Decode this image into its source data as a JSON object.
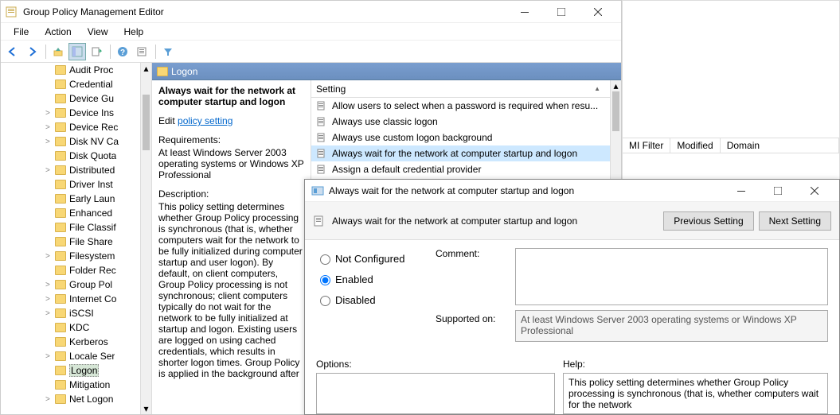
{
  "window": {
    "title": "Group Policy Management Editor"
  },
  "menu": {
    "file": "File",
    "action": "Action",
    "view": "View",
    "help": "Help"
  },
  "tree": {
    "items": [
      {
        "label": "Audit Proc",
        "exp": ""
      },
      {
        "label": "Credential",
        "exp": ""
      },
      {
        "label": "Device Gu",
        "exp": ""
      },
      {
        "label": "Device Ins",
        "exp": ">"
      },
      {
        "label": "Device Rec",
        "exp": ">"
      },
      {
        "label": "Disk NV Ca",
        "exp": ">"
      },
      {
        "label": "Disk Quota",
        "exp": ""
      },
      {
        "label": "Distributed",
        "exp": ">"
      },
      {
        "label": "Driver Inst",
        "exp": ""
      },
      {
        "label": "Early Laun",
        "exp": ""
      },
      {
        "label": "Enhanced",
        "exp": ""
      },
      {
        "label": "File Classif",
        "exp": ""
      },
      {
        "label": "File Share",
        "exp": ""
      },
      {
        "label": "Filesystem",
        "exp": ">"
      },
      {
        "label": "Folder Rec",
        "exp": ""
      },
      {
        "label": "Group Pol",
        "exp": ">"
      },
      {
        "label": "Internet Co",
        "exp": ">"
      },
      {
        "label": "iSCSI",
        "exp": ">"
      },
      {
        "label": "KDC",
        "exp": ""
      },
      {
        "label": "Kerberos",
        "exp": ""
      },
      {
        "label": "Locale Ser",
        "exp": ">"
      },
      {
        "label": "Logon",
        "exp": "",
        "selected": true
      },
      {
        "label": "Mitigation",
        "exp": ""
      },
      {
        "label": "Net Logon",
        "exp": ">"
      }
    ]
  },
  "path": {
    "label": "Logon"
  },
  "desc": {
    "title": "Always wait for the network at computer startup and logon",
    "edit_prefix": "Edit ",
    "edit_link": "policy setting ",
    "req_label": "Requirements:",
    "req_text": "At least Windows Server 2003 operating systems or Windows XP Professional",
    "d_label": "Description:",
    "d_text": "This policy setting determines whether Group Policy processing is synchronous (that is, whether computers wait for the network to be fully initialized during computer startup and user logon). By default, on client computers, Group Policy processing is not synchronous; client computers typically do not wait for the network to be fully initialized at startup and logon. Existing users are logged on using cached credentials, which results in shorter logon times. Group Policy is applied in the background after"
  },
  "settings": {
    "header": "Setting",
    "items": [
      "Allow users to select when a password is required when resu...",
      "Always use classic logon",
      "Always use custom logon background",
      "Always wait for the network at computer startup and logon",
      "Assign a default credential provider"
    ],
    "selected_index": 3
  },
  "right_cols": {
    "c1": "MI Filter",
    "c2": "Modified",
    "c3": "Domain"
  },
  "dialog": {
    "title": "Always wait for the network at computer startup and logon",
    "subtitle": "Always wait for the network at computer startup and logon",
    "prev": "Previous Setting",
    "next": "Next Setting",
    "state": {
      "not": "Not Configured",
      "en": "Enabled",
      "dis": "Disabled"
    },
    "comment_label": "Comment:",
    "support_label": "Supported on:",
    "support_text": "At least Windows Server 2003 operating systems or Windows XP Professional",
    "options_label": "Options:",
    "help_label": "Help:",
    "help_text": "This policy setting determines whether Group Policy processing is synchronous (that is, whether computers wait for the network"
  }
}
